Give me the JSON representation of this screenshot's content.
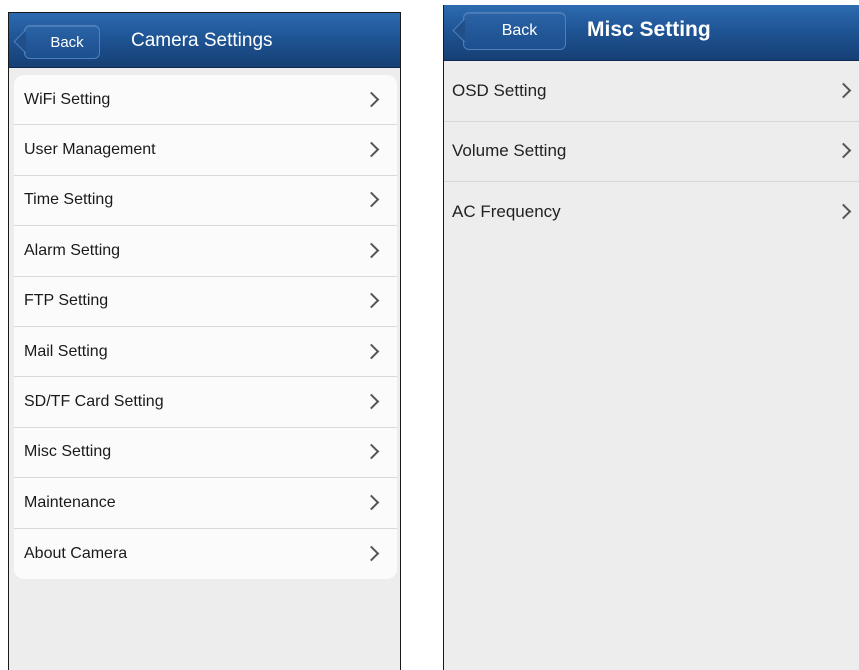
{
  "left_screen": {
    "back_label": "Back",
    "title": "Camera Settings",
    "items": [
      {
        "label": "WiFi Setting"
      },
      {
        "label": "User Management"
      },
      {
        "label": "Time Setting"
      },
      {
        "label": "Alarm Setting"
      },
      {
        "label": "FTP Setting"
      },
      {
        "label": "Mail Setting"
      },
      {
        "label": "SD/TF Card Setting"
      },
      {
        "label": "Misc Setting"
      },
      {
        "label": "Maintenance"
      },
      {
        "label": "About Camera"
      }
    ]
  },
  "right_screen": {
    "back_label": "Back",
    "title": "Misc Setting",
    "items": [
      {
        "label": "OSD Setting"
      },
      {
        "label": "Volume Setting"
      },
      {
        "label": "AC Frequency"
      }
    ]
  },
  "colors": {
    "navbar_blue": "#1f5595",
    "background": "#ededed",
    "list_card": "#fbfbfb"
  },
  "icons": {
    "row_disclosure": "chevron-right-icon",
    "back_button_shape": "arrow-left-shape"
  }
}
